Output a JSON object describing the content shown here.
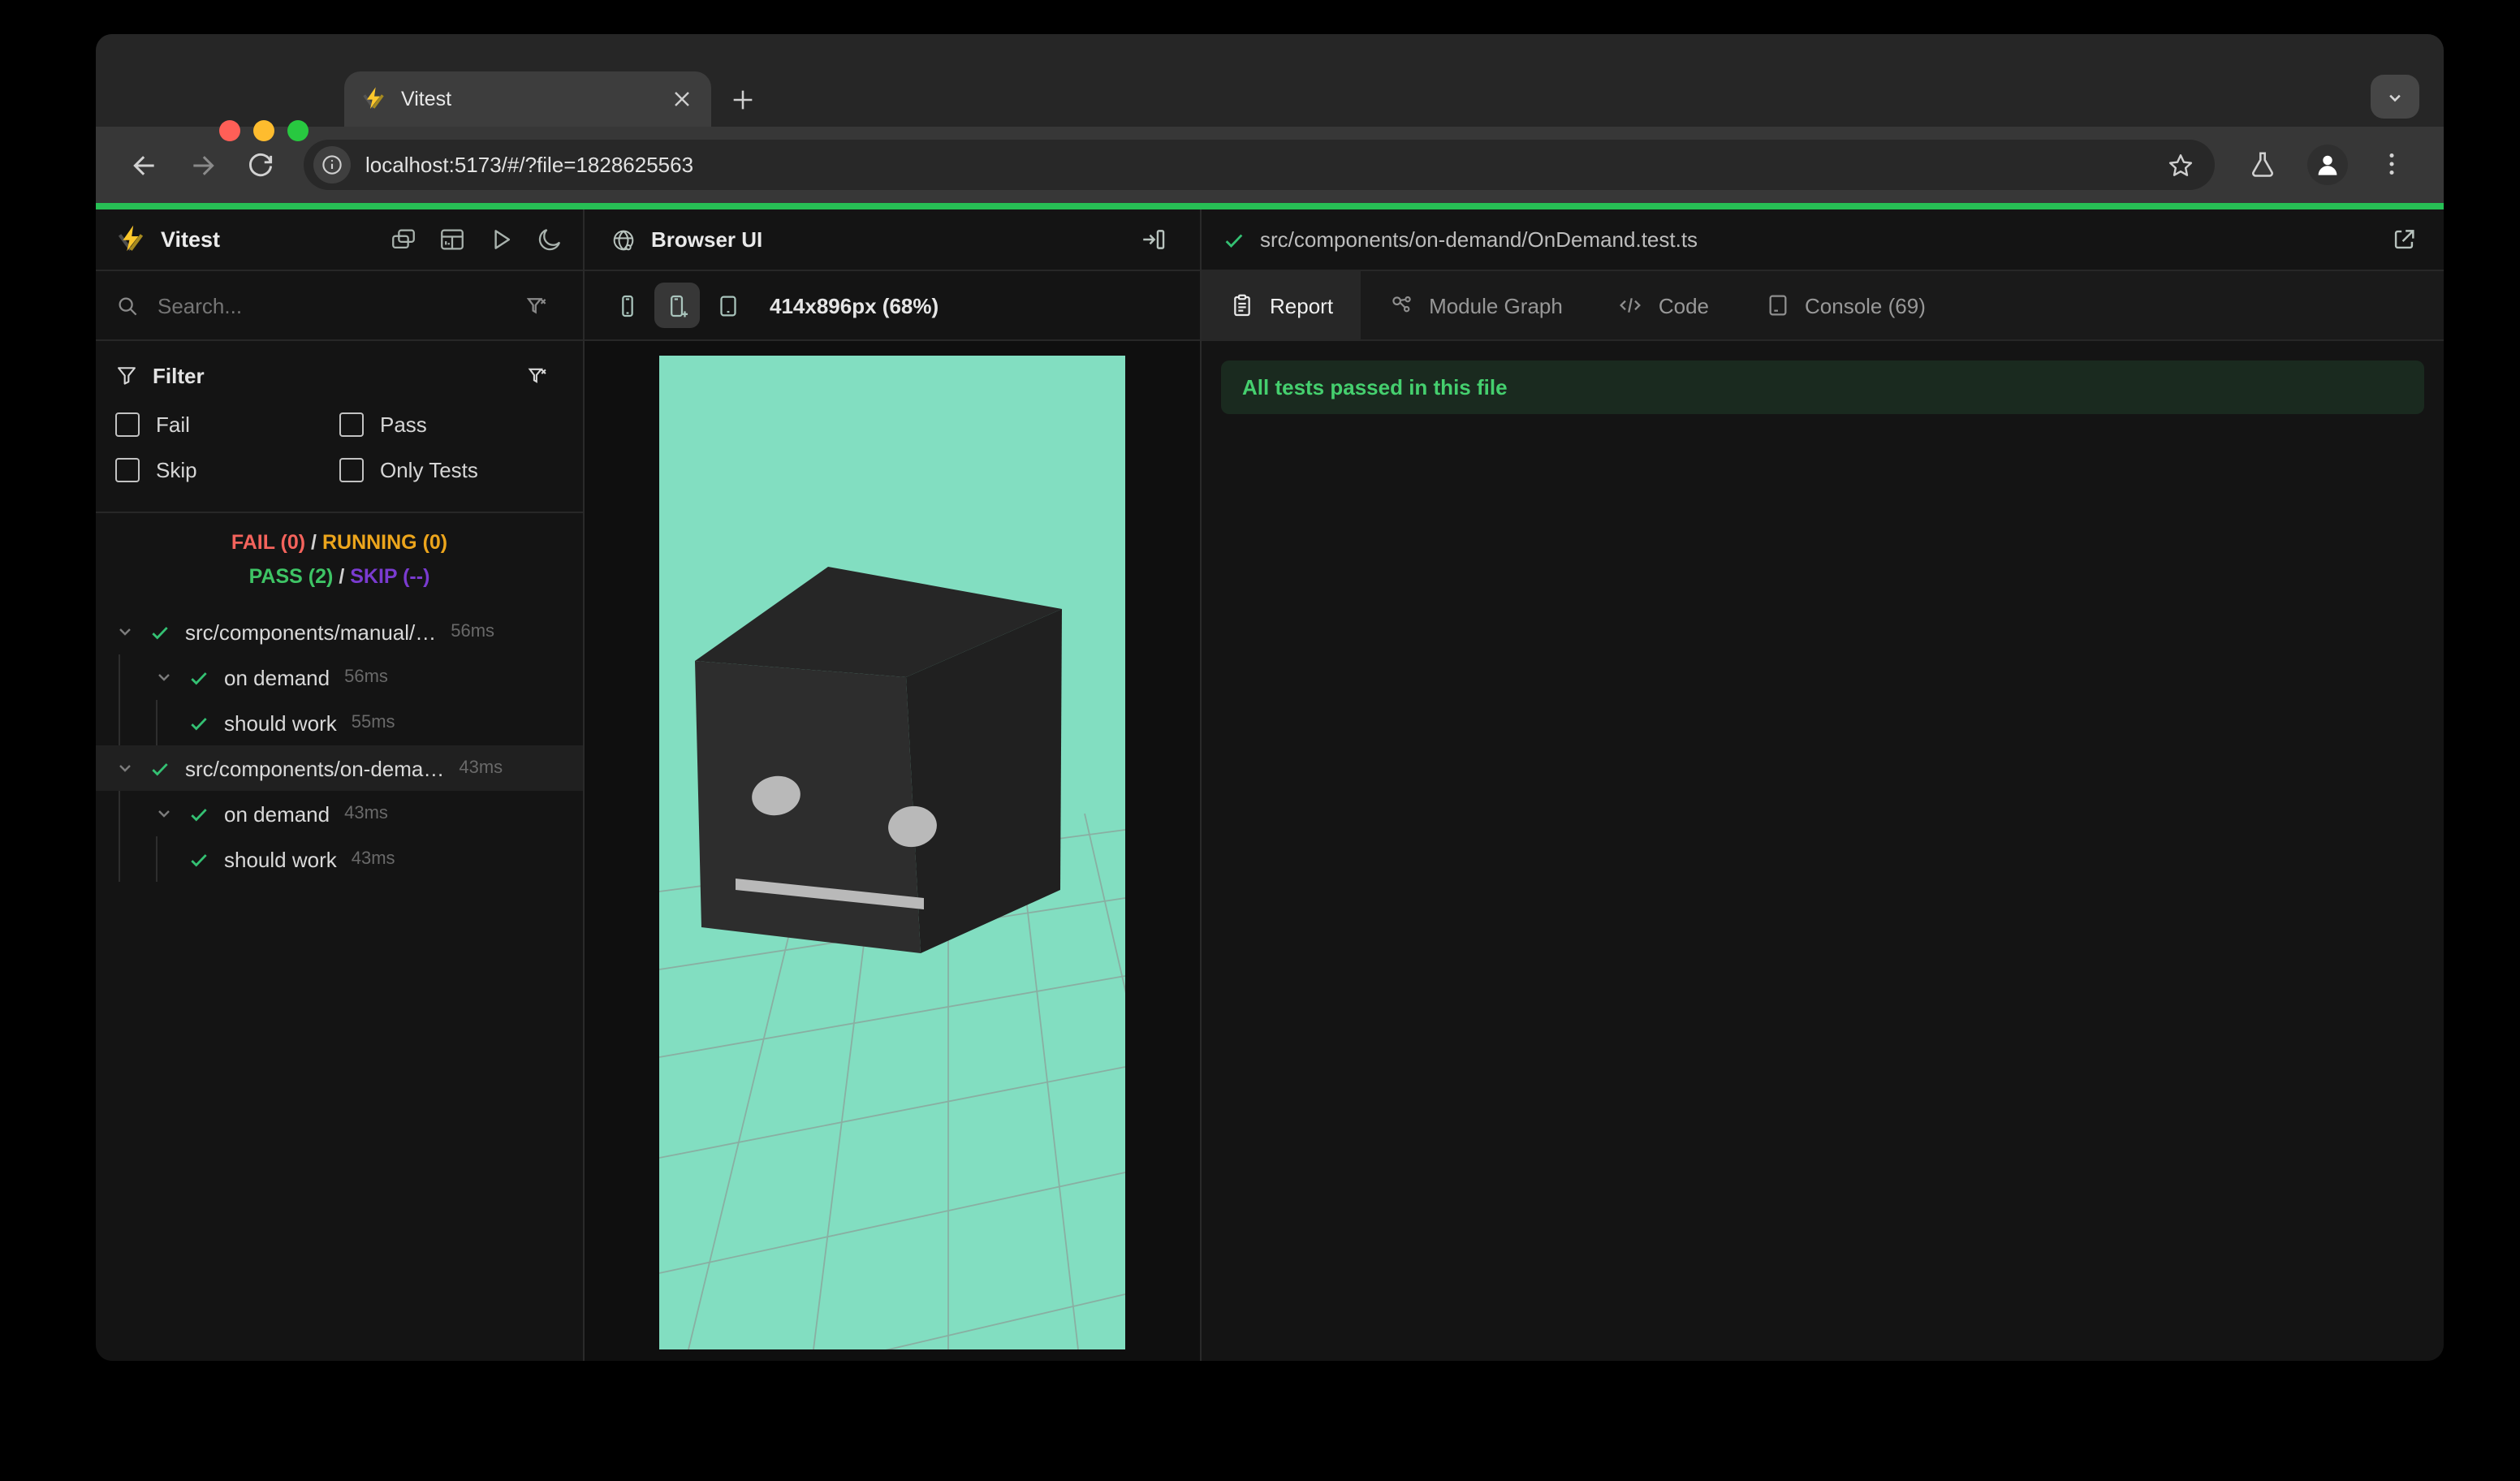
{
  "colors": {
    "progress_green": "#27bf55",
    "pass_green": "#3ec465",
    "fail_red": "#f4635c",
    "running_yellow": "#eca51c",
    "skip_purple": "#7a3bd0",
    "banner_text_green": "#45cf6e",
    "viewport_mint": "#82dec1"
  },
  "icons": {
    "traffic-lights": "red/yellow/green circles",
    "vitest-logo-icon": "yellow lightning bolt over V chevron",
    "close-icon": "×",
    "new-tab-icon": "+",
    "window-chevron-icon": "⌄",
    "back-icon": "←",
    "forward-icon": "→",
    "reload-icon": "⟳",
    "info-icon": "ⓘ",
    "star-icon": "☆",
    "flask-icon": "⚗",
    "profile-icon": "👤",
    "menu-dots-icon": "⋮",
    "collapse-panels-icon": "stacked panels",
    "dashboard-icon": "grid layout",
    "run-icon": "▷",
    "moon-icon": "☾",
    "search-icon": "⌕",
    "filter-icon": "funnel",
    "clear-filter-icon": "funnel with x",
    "checkbox": "□",
    "chevron-down-icon": "⌄",
    "check-icon": "✓",
    "globe-icon": "🌐",
    "open-panel-icon": "→|",
    "phone-icon": "phone outline",
    "phone-plus-icon": "phone with +",
    "tablet-icon": "tablet outline",
    "report-icon": "clipboard",
    "module-graph-icon": "connected nodes",
    "code-icon": "</>",
    "console-icon": "terminal box",
    "external-link-icon": "box with arrow"
  },
  "browser": {
    "tab_title": "Vitest",
    "url": "localhost:5173/#/?file=1828625563"
  },
  "sidebar": {
    "title": "Vitest",
    "search_placeholder": "Search...",
    "filter": {
      "title": "Filter",
      "options": [
        "Fail",
        "Pass",
        "Skip",
        "Only Tests"
      ]
    },
    "status": {
      "fail": "FAIL (0)",
      "running": "RUNNING (0)",
      "pass": "PASS (2)",
      "skip": "SKIP (--)",
      "separator": "/"
    },
    "tree": [
      {
        "label": "src/components/manual/…",
        "duration": "56ms",
        "level": "file"
      },
      {
        "label": "on demand",
        "duration": "56ms",
        "level": "suite"
      },
      {
        "label": "should work",
        "duration": "55ms",
        "level": "test"
      },
      {
        "label": "src/components/on-dema…",
        "duration": "43ms",
        "level": "file",
        "selected": true
      },
      {
        "label": "on demand",
        "duration": "43ms",
        "level": "suite"
      },
      {
        "label": "should work",
        "duration": "43ms",
        "level": "test"
      }
    ]
  },
  "browser_ui": {
    "title": "Browser UI",
    "dimensions": "414x896px (68%)"
  },
  "report": {
    "file_path": "src/components/on-demand/OnDemand.test.ts",
    "tabs": [
      {
        "label": "Report"
      },
      {
        "label": "Module Graph"
      },
      {
        "label": "Code"
      },
      {
        "label": "Console (69)"
      }
    ],
    "banner": "All tests passed in this file"
  }
}
